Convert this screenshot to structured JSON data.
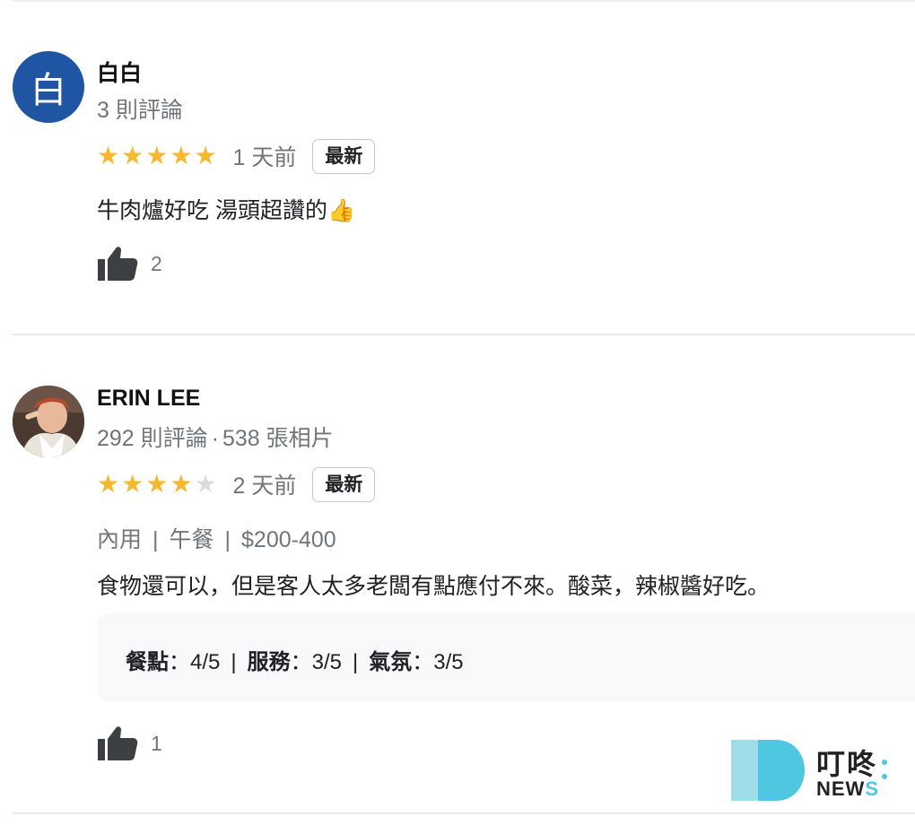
{
  "reviews": [
    {
      "avatar_letter": "白",
      "name": "白白",
      "reviews_count": "3 則評論",
      "rating": 5,
      "time": "1 天前",
      "badge": "最新",
      "text": "牛肉爐好吃  湯頭超讚的👍",
      "likes": "2"
    },
    {
      "name": "ERIN LEE",
      "reviews_count": "292 則評論",
      "meta_separator": "·",
      "photos_count": "538 張相片",
      "rating": 4,
      "time": "2 天前",
      "badge": "最新",
      "tags": [
        "內用",
        "午餐",
        "$200-400"
      ],
      "tag_separator": "|",
      "text": "食物還可以，但是客人太多老闆有點應付不來。酸菜，辣椒醬好吃。",
      "scores": [
        {
          "label": "餐點",
          "value": "：4/5"
        },
        {
          "label": "服務",
          "value": "：3/5"
        },
        {
          "label": "氣氛",
          "value": "：3/5"
        }
      ],
      "likes": "1"
    }
  ],
  "watermark": {
    "brand": "叮咚",
    "news_prefix": "NEW",
    "news_suffix": "S"
  },
  "colors": {
    "star_on": "#f5b82e",
    "star_off": "#dadce0",
    "avatar_bg": "#1f55a3",
    "watermark_accent": "#4fc7e0"
  }
}
